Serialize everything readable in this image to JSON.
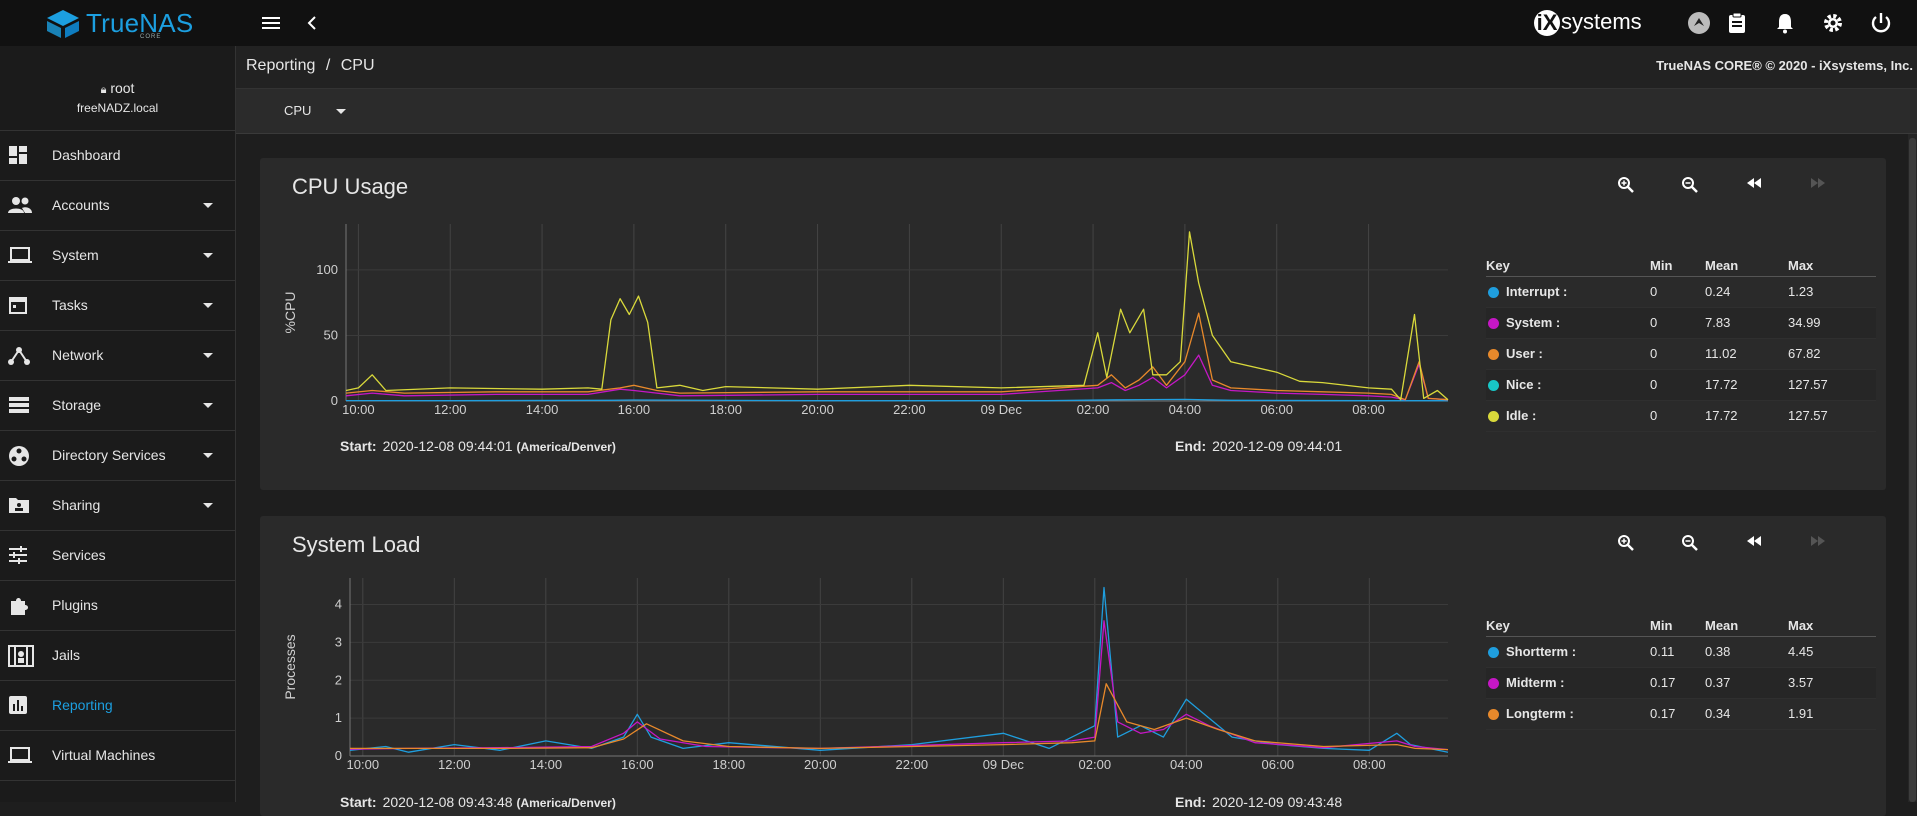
{
  "app": {
    "brand": "TrueNAS",
    "edition": "CORE",
    "vendor": "systems",
    "vendor_mark": "iX"
  },
  "user": {
    "name": "root",
    "hostname": "freeNADZ.local"
  },
  "sidebar": {
    "items": [
      {
        "label": "Dashboard",
        "icon": "dashboard-icon",
        "expandable": false
      },
      {
        "label": "Accounts",
        "icon": "accounts-icon",
        "expandable": true
      },
      {
        "label": "System",
        "icon": "laptop-icon",
        "expandable": true
      },
      {
        "label": "Tasks",
        "icon": "calendar-icon",
        "expandable": true
      },
      {
        "label": "Network",
        "icon": "network-icon",
        "expandable": true
      },
      {
        "label": "Storage",
        "icon": "storage-icon",
        "expandable": true
      },
      {
        "label": "Directory Services",
        "icon": "directory-icon",
        "expandable": true
      },
      {
        "label": "Sharing",
        "icon": "folder-share-icon",
        "expandable": true
      },
      {
        "label": "Services",
        "icon": "tune-icon",
        "expandable": false
      },
      {
        "label": "Plugins",
        "icon": "puzzle-icon",
        "expandable": false
      },
      {
        "label": "Jails",
        "icon": "jail-icon",
        "expandable": false
      },
      {
        "label": "Reporting",
        "icon": "chart-icon",
        "expandable": false,
        "active": true
      },
      {
        "label": "Virtual Machines",
        "icon": "laptop-icon",
        "expandable": false
      }
    ]
  },
  "breadcrumb": {
    "parent": "Reporting",
    "separator": "/",
    "current": "CPU"
  },
  "copyright": "TrueNAS CORE® © 2020 - iXsystems, Inc.",
  "toolbar": {
    "selected": "CPU"
  },
  "cards": [
    {
      "title": "CPU Usage",
      "ylabel": "%CPU",
      "start_label": "Start:",
      "start": "2020-12-08 09:44:01",
      "timezone": "(America/Denver)",
      "end_label": "End:",
      "end": "2020-12-09 09:44:01",
      "legend_headers": [
        "Key",
        "Min",
        "Mean",
        "Max"
      ],
      "legend": [
        {
          "name": "Interrupt :",
          "color": "#1f9ede",
          "min": "0",
          "mean": "0.24",
          "max": "1.23"
        },
        {
          "name": "System :",
          "color": "#c517c5",
          "min": "0",
          "mean": "7.83",
          "max": "34.99"
        },
        {
          "name": "User :",
          "color": "#e8892b",
          "min": "0",
          "mean": "11.02",
          "max": "67.82"
        },
        {
          "name": "Nice :",
          "color": "#18c6c6",
          "min": "0",
          "mean": "17.72",
          "max": "127.57"
        },
        {
          "name": "Idle :",
          "color": "#d9d93b",
          "min": "0",
          "mean": "17.72",
          "max": "127.57"
        }
      ]
    },
    {
      "title": "System Load",
      "ylabel": "Processes",
      "start_label": "Start:",
      "start": "2020-12-08 09:43:48",
      "timezone": "(America/Denver)",
      "end_label": "End:",
      "end": "2020-12-09 09:43:48",
      "legend_headers": [
        "Key",
        "Min",
        "Mean",
        "Max"
      ],
      "legend": [
        {
          "name": "Shortterm :",
          "color": "#1f9ede",
          "min": "0.11",
          "mean": "0.38",
          "max": "4.45"
        },
        {
          "name": "Midterm :",
          "color": "#c517c5",
          "min": "0.17",
          "mean": "0.37",
          "max": "3.57"
        },
        {
          "name": "Longterm :",
          "color": "#e8892b",
          "min": "0.17",
          "mean": "0.34",
          "max": "1.91"
        }
      ]
    }
  ],
  "chart_data": [
    {
      "type": "line",
      "title": "CPU Usage",
      "xlabel": "",
      "ylabel": "%CPU",
      "x_ticks": [
        "10:00",
        "12:00",
        "14:00",
        "16:00",
        "18:00",
        "20:00",
        "22:00",
        "09 Dec",
        "02:00",
        "04:00",
        "06:00",
        "08:00"
      ],
      "y_ticks": [
        0,
        50,
        100
      ],
      "ylim": [
        0,
        135
      ],
      "x_hours": [
        9.73,
        33.73
      ],
      "grid": true,
      "series": [
        {
          "name": "Interrupt",
          "color": "#1f9ede",
          "points": [
            [
              9.73,
              0.3
            ],
            [
              12,
              0.2
            ],
            [
              15.5,
              0.5
            ],
            [
              16,
              0.8
            ],
            [
              20,
              0.2
            ],
            [
              25,
              0.2
            ],
            [
              26.5,
              0.9
            ],
            [
              28,
              1.2
            ],
            [
              29,
              0.5
            ],
            [
              32,
              0.2
            ],
            [
              33.73,
              0.2
            ]
          ]
        },
        {
          "name": "System",
          "color": "#c517c5",
          "points": [
            [
              9.73,
              4
            ],
            [
              10.3,
              6
            ],
            [
              11,
              4
            ],
            [
              13,
              5
            ],
            [
              15,
              5
            ],
            [
              15.7,
              9
            ],
            [
              16,
              8
            ],
            [
              16.5,
              6
            ],
            [
              17,
              4
            ],
            [
              20,
              5
            ],
            [
              24,
              5
            ],
            [
              26.1,
              10
            ],
            [
              26.4,
              14
            ],
            [
              26.7,
              8
            ],
            [
              27,
              12
            ],
            [
              27.3,
              18
            ],
            [
              27.6,
              10
            ],
            [
              28,
              20
            ],
            [
              28.3,
              35
            ],
            [
              28.6,
              12
            ],
            [
              29,
              8
            ],
            [
              30,
              6
            ],
            [
              31,
              5
            ],
            [
              32,
              4
            ],
            [
              32.5,
              3
            ],
            [
              32.8,
              1
            ],
            [
              33.1,
              28
            ],
            [
              33.3,
              2
            ],
            [
              33.73,
              1
            ]
          ]
        },
        {
          "name": "User",
          "color": "#e8892b",
          "points": [
            [
              9.73,
              6
            ],
            [
              10.3,
              8
            ],
            [
              11,
              6
            ],
            [
              13,
              7
            ],
            [
              15,
              7
            ],
            [
              15.7,
              10
            ],
            [
              16,
              12
            ],
            [
              16.5,
              8
            ],
            [
              17,
              6
            ],
            [
              20,
              7
            ],
            [
              24,
              7
            ],
            [
              26.1,
              12
            ],
            [
              26.4,
              20
            ],
            [
              26.7,
              10
            ],
            [
              27,
              16
            ],
            [
              27.3,
              26
            ],
            [
              27.6,
              12
            ],
            [
              28,
              30
            ],
            [
              28.3,
              67
            ],
            [
              28.6,
              16
            ],
            [
              29,
              10
            ],
            [
              30,
              8
            ],
            [
              31,
              7
            ],
            [
              32,
              6
            ],
            [
              32.5,
              5
            ],
            [
              32.8,
              1
            ],
            [
              33.1,
              30
            ],
            [
              33.3,
              2
            ],
            [
              33.73,
              1
            ]
          ]
        },
        {
          "name": "Idle",
          "color": "#d9d93b",
          "points": [
            [
              9.73,
              8
            ],
            [
              10,
              10
            ],
            [
              10.3,
              20
            ],
            [
              10.6,
              8
            ],
            [
              12,
              10
            ],
            [
              14,
              9
            ],
            [
              15,
              10
            ],
            [
              15.3,
              9
            ],
            [
              15.5,
              62
            ],
            [
              15.7,
              78
            ],
            [
              15.9,
              66
            ],
            [
              16.1,
              80
            ],
            [
              16.3,
              60
            ],
            [
              16.5,
              10
            ],
            [
              17,
              12
            ],
            [
              17.5,
              8
            ],
            [
              18,
              11
            ],
            [
              20,
              9
            ],
            [
              22,
              12
            ],
            [
              24,
              10
            ],
            [
              25.8,
              12
            ],
            [
              26.1,
              52
            ],
            [
              26.3,
              18
            ],
            [
              26.6,
              70
            ],
            [
              26.8,
              52
            ],
            [
              27.1,
              70
            ],
            [
              27.3,
              20
            ],
            [
              27.6,
              20
            ],
            [
              27.9,
              30
            ],
            [
              28.1,
              129
            ],
            [
              28.3,
              90
            ],
            [
              28.6,
              50
            ],
            [
              29,
              30
            ],
            [
              30,
              22
            ],
            [
              30.5,
              15
            ],
            [
              31,
              14
            ],
            [
              32,
              10
            ],
            [
              32.5,
              9
            ],
            [
              32.7,
              1
            ],
            [
              33.0,
              66
            ],
            [
              33.2,
              2
            ],
            [
              33.5,
              8
            ],
            [
              33.73,
              1
            ]
          ]
        }
      ]
    },
    {
      "type": "line",
      "title": "System Load",
      "xlabel": "",
      "ylabel": "Processes",
      "x_ticks": [
        "10:00",
        "12:00",
        "14:00",
        "16:00",
        "18:00",
        "20:00",
        "22:00",
        "09 Dec",
        "02:00",
        "04:00",
        "06:00",
        "08:00"
      ],
      "y_ticks": [
        0,
        1,
        2,
        3,
        4
      ],
      "ylim": [
        0,
        4.7
      ],
      "x_hours": [
        9.72,
        33.72
      ],
      "grid": true,
      "series": [
        {
          "name": "Shortterm",
          "color": "#1f9ede",
          "points": [
            [
              9.72,
              0.15
            ],
            [
              10.5,
              0.25
            ],
            [
              11,
              0.1
            ],
            [
              12,
              0.3
            ],
            [
              13,
              0.15
            ],
            [
              14,
              0.4
            ],
            [
              15,
              0.2
            ],
            [
              15.7,
              0.5
            ],
            [
              16,
              1.1
            ],
            [
              16.3,
              0.5
            ],
            [
              17,
              0.2
            ],
            [
              18,
              0.35
            ],
            [
              20,
              0.15
            ],
            [
              22,
              0.3
            ],
            [
              24,
              0.6
            ],
            [
              25,
              0.2
            ],
            [
              26,
              0.8
            ],
            [
              26.2,
              4.45
            ],
            [
              26.5,
              0.5
            ],
            [
              27,
              0.8
            ],
            [
              27.5,
              0.5
            ],
            [
              28,
              1.5
            ],
            [
              28.3,
              1.2
            ],
            [
              29,
              0.5
            ],
            [
              30,
              0.3
            ],
            [
              31,
              0.2
            ],
            [
              32,
              0.15
            ],
            [
              32.6,
              0.6
            ],
            [
              32.9,
              0.3
            ],
            [
              33.72,
              0.1
            ]
          ]
        },
        {
          "name": "Midterm",
          "color": "#c517c5",
          "points": [
            [
              9.72,
              0.18
            ],
            [
              11,
              0.2
            ],
            [
              13,
              0.22
            ],
            [
              15,
              0.25
            ],
            [
              15.7,
              0.6
            ],
            [
              16,
              0.9
            ],
            [
              16.5,
              0.45
            ],
            [
              17.5,
              0.25
            ],
            [
              20,
              0.2
            ],
            [
              24,
              0.35
            ],
            [
              25.5,
              0.4
            ],
            [
              26,
              0.5
            ],
            [
              26.2,
              3.57
            ],
            [
              26.5,
              0.9
            ],
            [
              27,
              0.6
            ],
            [
              27.5,
              0.7
            ],
            [
              28,
              1.1
            ],
            [
              28.5,
              0.8
            ],
            [
              29.5,
              0.35
            ],
            [
              31,
              0.22
            ],
            [
              32.6,
              0.4
            ],
            [
              33,
              0.25
            ],
            [
              33.72,
              0.17
            ]
          ]
        },
        {
          "name": "Longterm",
          "color": "#e8892b",
          "points": [
            [
              9.72,
              0.2
            ],
            [
              11,
              0.2
            ],
            [
              13,
              0.2
            ],
            [
              15,
              0.22
            ],
            [
              15.7,
              0.45
            ],
            [
              16.2,
              0.85
            ],
            [
              17,
              0.4
            ],
            [
              18,
              0.25
            ],
            [
              20,
              0.2
            ],
            [
              24,
              0.3
            ],
            [
              25.5,
              0.35
            ],
            [
              26,
              0.4
            ],
            [
              26.25,
              1.91
            ],
            [
              26.7,
              0.9
            ],
            [
              27.3,
              0.7
            ],
            [
              28,
              1.0
            ],
            [
              28.7,
              0.7
            ],
            [
              29.5,
              0.4
            ],
            [
              31,
              0.25
            ],
            [
              32.6,
              0.3
            ],
            [
              33,
              0.2
            ],
            [
              33.72,
              0.17
            ]
          ]
        }
      ]
    }
  ]
}
